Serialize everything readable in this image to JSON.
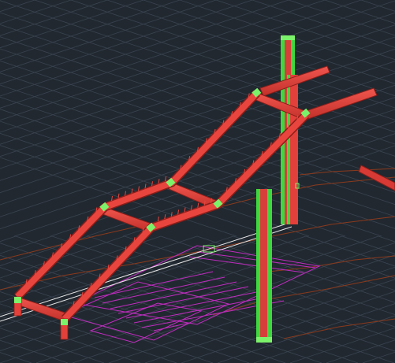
{
  "viewport": {
    "background": "#212830",
    "grid_color": "#3a4450",
    "beam_color": "#e2403a",
    "beam_dark": "#a82a26",
    "column_color": "#3ed83e",
    "connection_color": "#7cf26a",
    "stair_pad_color": "#c02cc0",
    "terrain_color": "#8a3a1c",
    "slab_edge_color": "#e6e6e6"
  },
  "objects": {
    "stair_frame": "steel-stair-frame",
    "columns": [
      "column-back-left",
      "column-back-right",
      "column-front"
    ],
    "stringers": [
      "stringer-left",
      "stringer-right"
    ],
    "landings": [
      "landing-beam-1",
      "landing-beam-2",
      "landing-beam-3",
      "landing-beam-top"
    ],
    "top_beams": [
      "top-beam-left",
      "top-beam-right"
    ],
    "off_screen_beam": "partial-beam-right-edge"
  }
}
